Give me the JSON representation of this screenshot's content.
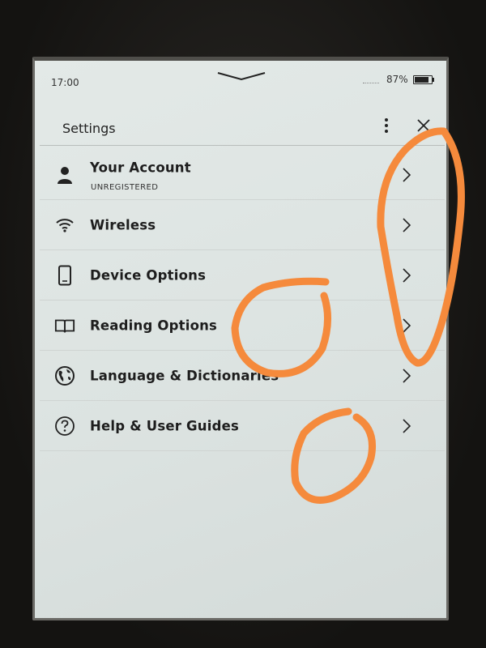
{
  "status_bar": {
    "time": "17:00",
    "battery_percent": "87%",
    "battery_level": 0.87
  },
  "header": {
    "title": "Settings",
    "menu_icon": "more-vertical-icon",
    "close_icon": "close-icon"
  },
  "settings": {
    "items": [
      {
        "label": "Your Account",
        "sublabel": "UNREGISTERED",
        "icon": "person-icon"
      },
      {
        "label": "Wireless",
        "icon": "wifi-icon"
      },
      {
        "label": "Device Options",
        "icon": "device-icon"
      },
      {
        "label": "Reading Options",
        "icon": "book-icon"
      },
      {
        "label": "Language & Dictionaries",
        "icon": "globe-icon"
      },
      {
        "label": "Help & User Guides",
        "icon": "help-icon"
      }
    ]
  },
  "colors": {
    "screen_background": "#dfe5e3",
    "annotation_orange": "#f58a3c",
    "text": "#1d1d1d"
  }
}
